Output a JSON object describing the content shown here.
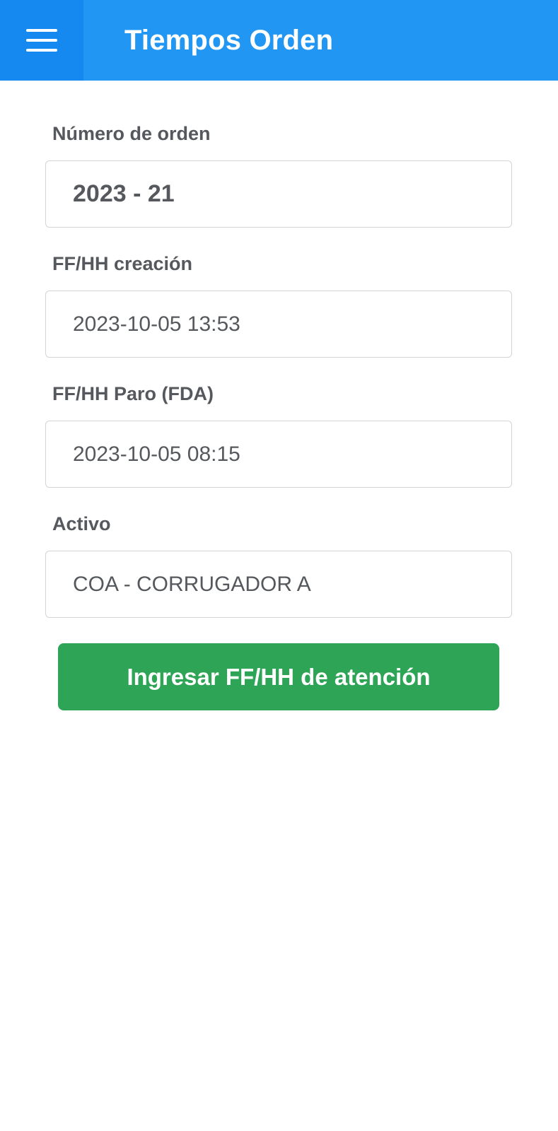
{
  "app_bar": {
    "title": "Tiempos Orden",
    "menu_icon": "hamburger-menu-icon",
    "background": "#2196f3",
    "menu_background": "#1589f0"
  },
  "form": {
    "order_number": {
      "label": "Número de orden",
      "value": "2023 - 21"
    },
    "creation_datetime": {
      "label": "FF/HH creación",
      "value": "2023-10-05 13:53"
    },
    "stop_datetime": {
      "label": "FF/HH Paro (FDA)",
      "value": "2023-10-05 08:15"
    },
    "asset": {
      "label": "Activo",
      "value": "COA - CORRUGADOR A"
    }
  },
  "action": {
    "label": "Ingresar FF/HH de atención",
    "color": "#2ea556"
  }
}
